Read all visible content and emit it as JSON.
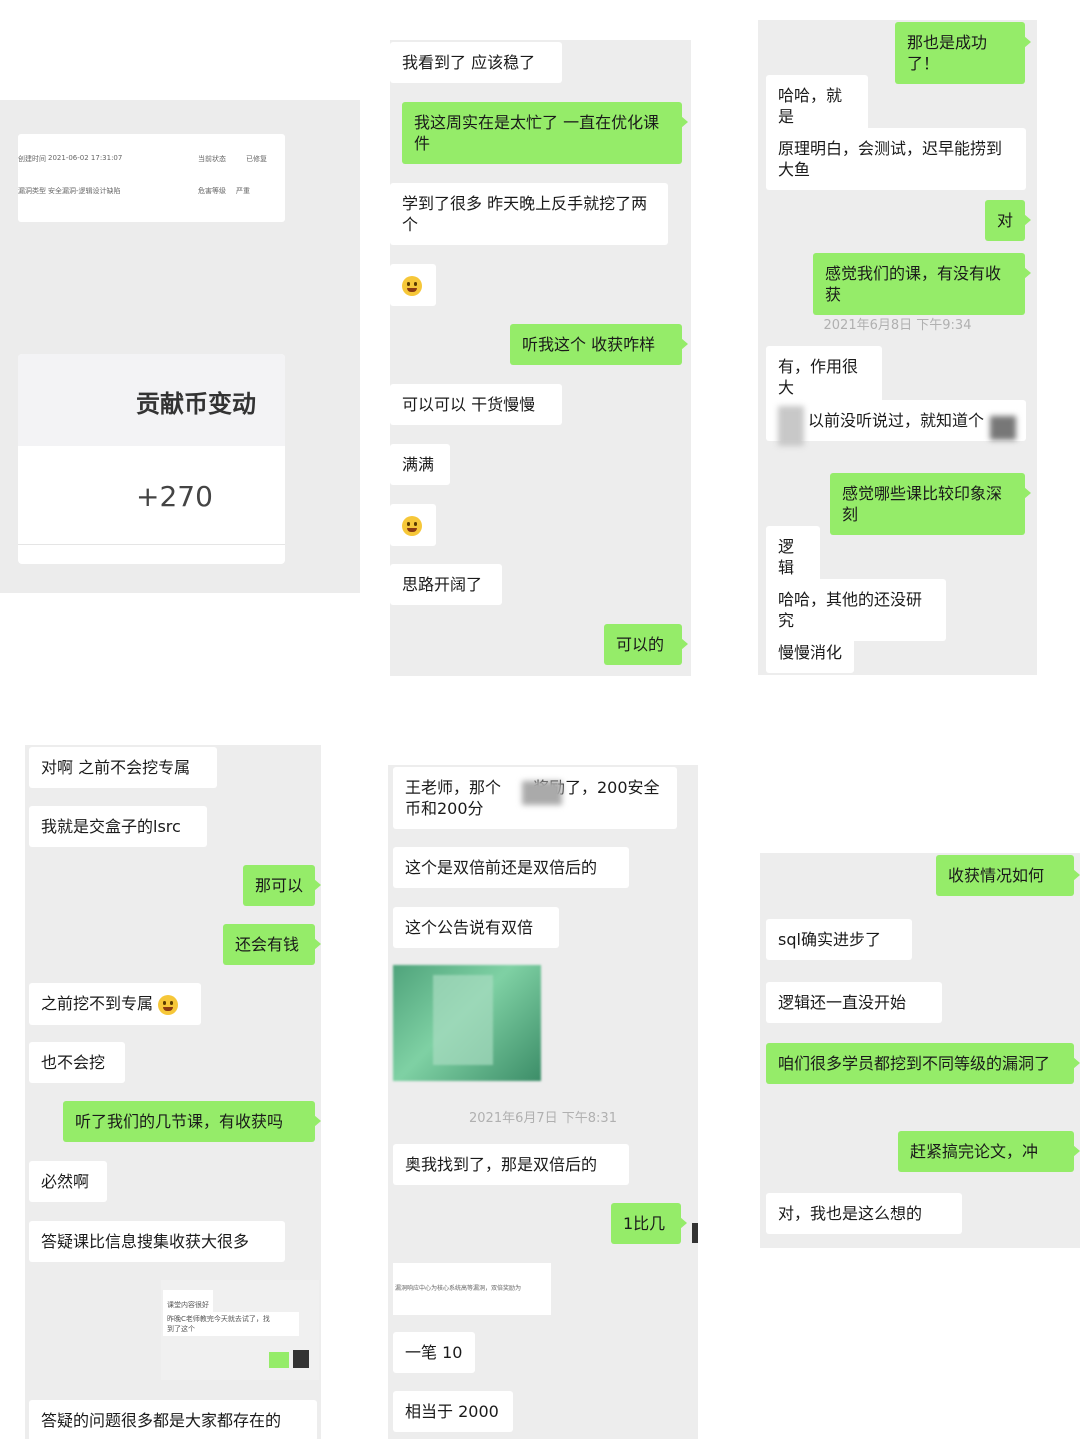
{
  "panel1": {
    "record": {
      "r1_label": "创建时间",
      "r1_value": "2021-06-02 17:31:07",
      "r1_status_label": "当前状态",
      "r1_status": "已修复",
      "r2_label": "漏洞类型",
      "r2_value": "安全漏洞-逻辑设计缺陷",
      "r2_level_label": "危害等级",
      "r2_level": "严重"
    },
    "card_title": "贡献币变动",
    "card_value": "+270"
  },
  "panel2": {
    "messages": [
      {
        "side": "left",
        "text": "我看到了 应该稳了"
      },
      {
        "side": "right",
        "text": "我这周实在是太忙了 一直在优化课件"
      },
      {
        "side": "left",
        "text": "学到了很多 昨天晚上反手就挖了两个"
      },
      {
        "side": "left",
        "text": "",
        "emoji": "laugh-emoji"
      },
      {
        "side": "right",
        "text": "听我这个 收获咋样"
      },
      {
        "side": "left",
        "text": "可以可以 干货慢慢"
      },
      {
        "side": "left",
        "text": "满满"
      },
      {
        "side": "left",
        "text": "",
        "emoji": "laugh-emoji"
      },
      {
        "side": "left",
        "text": "思路开阔了"
      },
      {
        "side": "right",
        "text": "可以的"
      }
    ]
  },
  "panel3": {
    "messages": [
      {
        "side": "right",
        "text": "那也是成功了！"
      },
      {
        "side": "left",
        "text": "哈哈，就是"
      },
      {
        "side": "left",
        "text": "原理明白，会测试，迟早能捞到大鱼"
      },
      {
        "side": "right",
        "text": "对"
      },
      {
        "side": "right",
        "text": "感觉我们的课，有没有收获"
      },
      {
        "side": "left",
        "text": "有，作用很大"
      },
      {
        "side": "left",
        "text": "以前没听说过，就知道个"
      },
      {
        "side": "right",
        "text": "感觉哪些课比较印象深刻"
      },
      {
        "side": "left",
        "text": "逻辑"
      },
      {
        "side": "left",
        "text": "哈哈，其他的还没研究"
      },
      {
        "side": "left",
        "text": "慢慢消化"
      }
    ],
    "timestamp": "2021年6月8日 下午9:34"
  },
  "panel4": {
    "messages": [
      {
        "side": "left",
        "text": "对啊 之前不会挖专属"
      },
      {
        "side": "left",
        "text": "我就是交盒子的lsrc"
      },
      {
        "side": "right",
        "text": "那可以"
      },
      {
        "side": "right",
        "text": "还会有钱"
      },
      {
        "side": "left",
        "text": "之前挖不到专属"
      },
      {
        "side": "left",
        "text": "也不会挖"
      },
      {
        "side": "right",
        "text": "听了我们的几节课，有收获吗"
      },
      {
        "side": "left",
        "text": "必然啊"
      },
      {
        "side": "left",
        "text": "答疑课比信息搜集收获大很多"
      },
      {
        "side": "left",
        "text": "答疑的问题很多都是大家都存在的"
      }
    ],
    "inner_chat": {
      "line1": "课堂内容很好",
      "line2": "昨晚C老师教完今天就去试了，找",
      "line3": "到了这个"
    }
  },
  "panel5": {
    "messages": [
      {
        "side": "left",
        "text": "王老师，那个　　奖励了，200安全币和200分"
      },
      {
        "side": "left",
        "text": "这个是双倍前还是双倍后的"
      },
      {
        "side": "left",
        "text": "这个公告说有双倍"
      },
      {
        "side": "left",
        "text": "奥我找到了，那是双倍后的"
      },
      {
        "side": "right",
        "text": "1比几"
      },
      {
        "side": "left",
        "text": "一笔 10"
      },
      {
        "side": "left",
        "text": "相当于 2000"
      }
    ],
    "timestamp": "2021年6月7日 下午8:31",
    "notice_text": "漏洞响应中心为核心系统高等漏洞，双倍奖励为"
  },
  "panel6": {
    "messages": [
      {
        "side": "right",
        "text": "收获情况如何"
      },
      {
        "side": "left",
        "text": "sql确实进步了"
      },
      {
        "side": "left",
        "text": "逻辑还一直没开始"
      },
      {
        "side": "right",
        "text": "咱们很多学员都挖到不同等级的漏洞了"
      },
      {
        "side": "right",
        "text": "赶紧搞完论文，冲"
      },
      {
        "side": "left",
        "text": "对，我也是这么想的"
      }
    ]
  },
  "colors": {
    "chat_bg": "#ededed",
    "left_bubble": "#ffffff",
    "right_bubble": "#95ec69",
    "timestamp": "#b0b0b0"
  }
}
